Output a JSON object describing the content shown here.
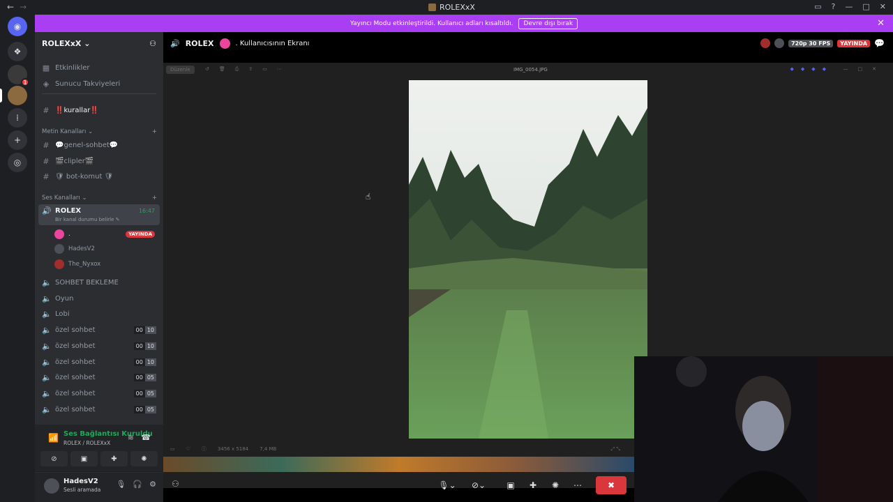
{
  "window": {
    "title": "ROLEXxX"
  },
  "banner": {
    "text": "Yayıncı Modu etkinleştirildi. Kullanıcı adları kısaltıldı.",
    "button": "Devre dışı bırak"
  },
  "server": {
    "name": "ROLEXxX"
  },
  "sidebar": {
    "top_items": [
      {
        "label": "Etkinlikler"
      },
      {
        "label": "Sunucu Takviyeleri"
      }
    ],
    "rules_channel": "‼️kurallar‼️",
    "text_category": "Metin Kanalları",
    "text_channels": [
      {
        "label": "💬genel-sohbet💬"
      },
      {
        "label": "🎬clipler🎬"
      },
      {
        "label": "🛡 bot-komut 🛡"
      }
    ],
    "voice_category": "Ses Kanalları",
    "active_voice": {
      "name": "ROLEX",
      "time": "16:47",
      "status": "Bir kanal durumu belirle"
    },
    "voice_users": [
      {
        "name": ".",
        "live": "YAYINDA"
      },
      {
        "name": "HadesV2"
      },
      {
        "name": "The_Nyxox"
      }
    ],
    "voice_channels": [
      {
        "label": "SOHBET BEKLEME"
      },
      {
        "label": "Oyun"
      },
      {
        "label": "Lobi"
      },
      {
        "label": "özel sohbet",
        "a": "00",
        "b": "10"
      },
      {
        "label": "özel sohbet",
        "a": "00",
        "b": "10"
      },
      {
        "label": "özel sohbet",
        "a": "00",
        "b": "10"
      },
      {
        "label": "özel sohbet",
        "a": "00",
        "b": "05"
      },
      {
        "label": "özel sohbet",
        "a": "00",
        "b": "05"
      },
      {
        "label": "özel sohbet",
        "a": "00",
        "b": "05"
      }
    ]
  },
  "voice_panel": {
    "status": "Ses Bağlantısı Kuruldu",
    "location": "ROLEX / ROLEXxX"
  },
  "user_panel": {
    "name": "HadesV2",
    "status": "Sesli aramada"
  },
  "stage": {
    "channel": "ROLEX",
    "stream_title": ". Kullanıcısının Ekranı",
    "quality": "720p 30 FPS",
    "live": "YAYINDA"
  },
  "viewer": {
    "filename": "IMG_0054.JPG",
    "edit_label": "Düzenle",
    "info_dims": "3456 x 5184",
    "info_size": "7,4 MB"
  },
  "colors": {
    "banner": "#a93ef3",
    "live": "#da373c",
    "connected": "#23a55a",
    "brand": "#5865f2"
  }
}
